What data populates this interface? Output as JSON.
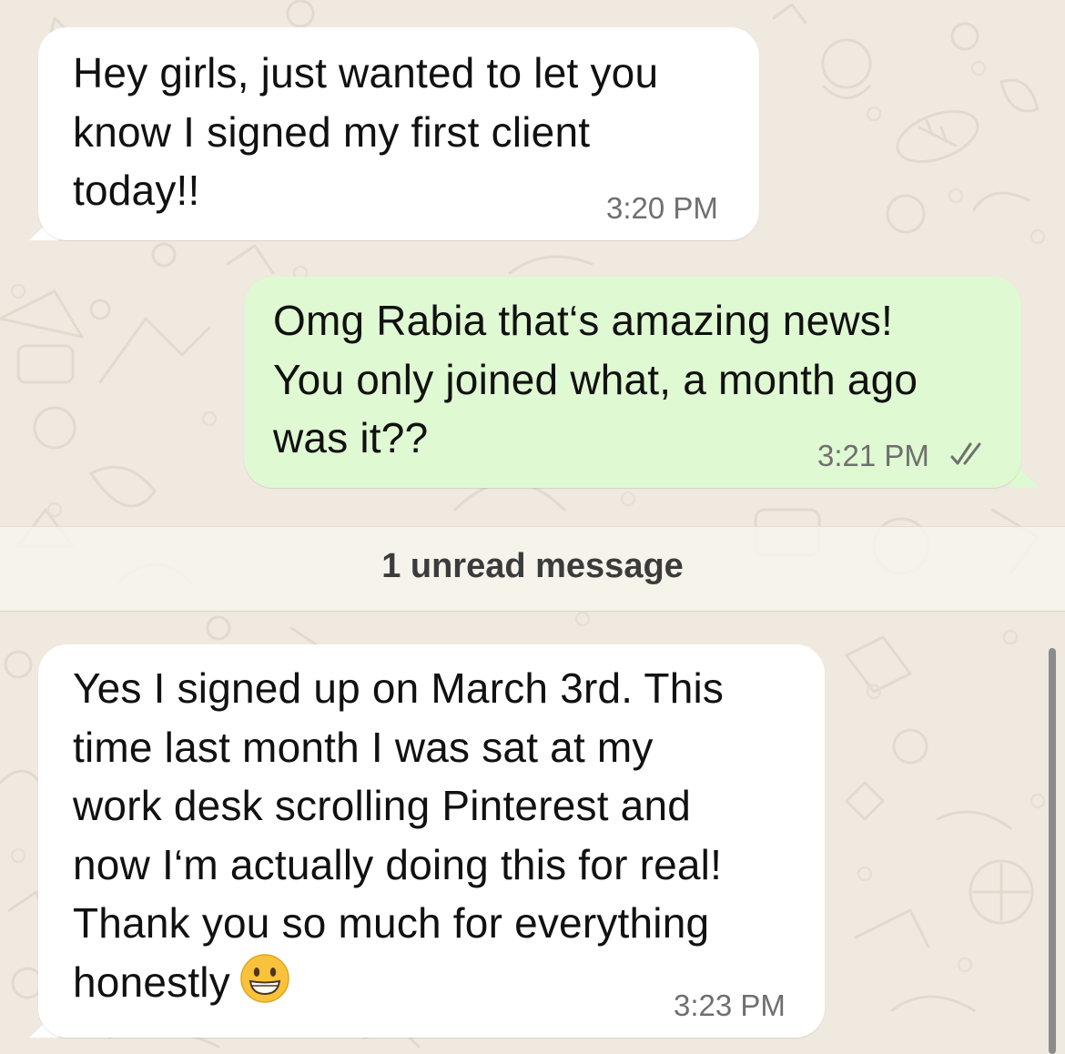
{
  "chat": {
    "messages": [
      {
        "direction": "incoming",
        "text": "Hey girls, just wanted to let you know I signed my first client today!!",
        "lines": [
          "Hey girls, just wanted to let you",
          "know I signed my first client",
          "today!!"
        ],
        "time": "3:20 PM"
      },
      {
        "direction": "outgoing",
        "text": "Omg Rabia that’s amazing news! You only joined what, a month ago was it??",
        "lines": [
          "Omg Rabia that‘s amazing news!",
          "You only joined what, a month ago",
          "was it??"
        ],
        "time": "3:21 PM",
        "status": "read"
      },
      {
        "direction": "incoming",
        "text": "Yes I signed up on March 3rd. This time last month I was sat at my work desk scrolling Pinterest and now I’m actually doing this for real! Thank you so much for everything honestly 😁",
        "lines": [
          "Yes I signed up on March 3rd. This",
          "time last month I was sat at my",
          "work desk scrolling Pinterest and",
          "now I‘m actually doing this for real!",
          "Thank you so much for everything",
          "honestly"
        ],
        "emoji": "grinning-face",
        "time": "3:23 PM"
      }
    ],
    "unread_divider": "1 unread message"
  },
  "colors": {
    "wallpaper": "#efe9df",
    "incoming_bubble": "#ffffff",
    "outgoing_bubble": "#dff9d2",
    "timestamp": "#6f6f6f",
    "read_ticks": "#6f6f6f"
  }
}
